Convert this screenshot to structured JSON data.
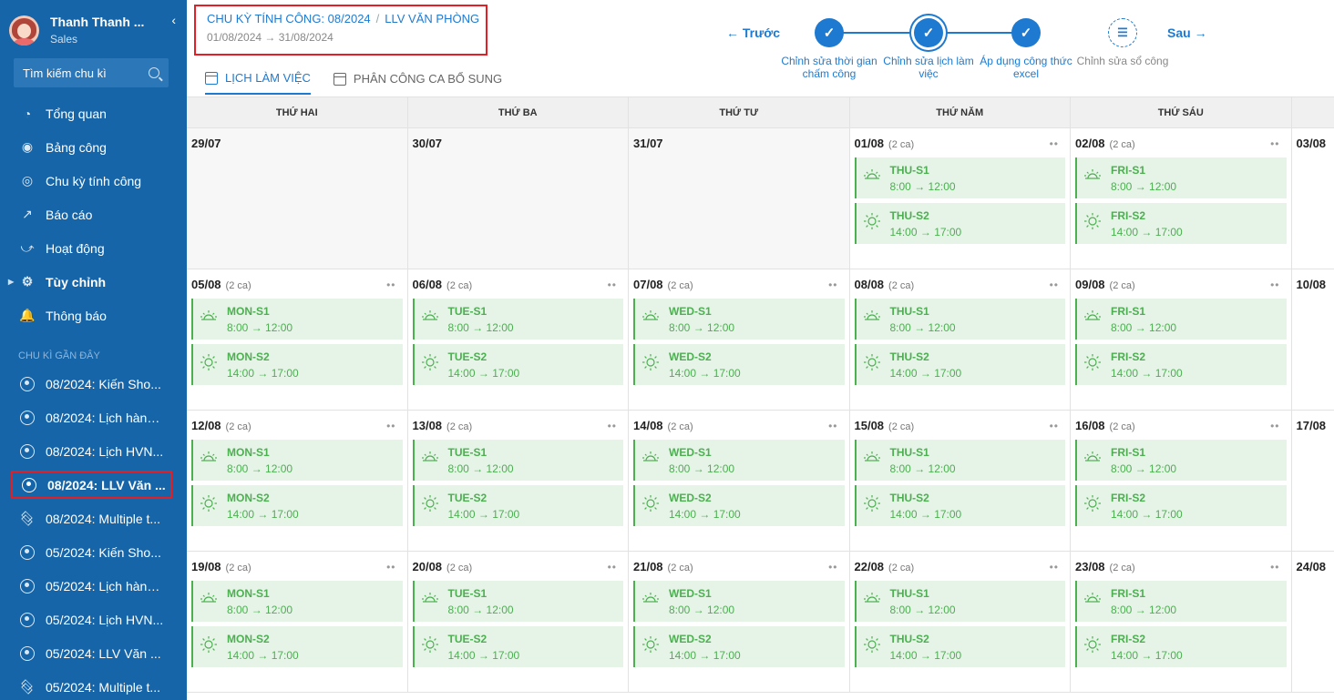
{
  "user": {
    "name": "Thanh Thanh ...",
    "role": "Sales"
  },
  "search": {
    "placeholder": "Tìm kiếm chu kì"
  },
  "nav": [
    {
      "label": "Tổng quan",
      "icon": "clock-icon"
    },
    {
      "label": "Bảng công",
      "icon": "user-icon"
    },
    {
      "label": "Chu kỳ tính công",
      "icon": "cycle-icon"
    },
    {
      "label": "Báo cáo",
      "icon": "chart-icon"
    },
    {
      "label": "Hoạt động",
      "icon": "activity-icon"
    },
    {
      "label": "Tùy chỉnh",
      "icon": "gear-icon"
    },
    {
      "label": "Thông báo",
      "icon": "bell-icon"
    }
  ],
  "recent_label": "CHU KÌ GẦN ĐÂY",
  "recent": [
    {
      "label": "08/2024: Kiến Sho...",
      "icon": "radio"
    },
    {
      "label": "08/2024: Lịch hành...",
      "icon": "radio"
    },
    {
      "label": "08/2024: Lịch HVN...",
      "icon": "radio"
    },
    {
      "label": "08/2024: LLV Văn ...",
      "icon": "radio",
      "active": true
    },
    {
      "label": "08/2024: Multiple t...",
      "icon": "layers"
    },
    {
      "label": "05/2024: Kiến Sho...",
      "icon": "radio"
    },
    {
      "label": "05/2024: Lịch hành...",
      "icon": "radio"
    },
    {
      "label": "05/2024: Lịch HVN...",
      "icon": "radio"
    },
    {
      "label": "05/2024: LLV Văn ...",
      "icon": "radio"
    },
    {
      "label": "05/2024: Multiple t...",
      "icon": "layers"
    }
  ],
  "header": {
    "cycle": "CHU KỲ TÍNH CÔNG: 08/2024",
    "schedule": "LLV VĂN PHÒNG",
    "start": "01/08/2024",
    "end": "31/08/2024"
  },
  "tabs": [
    "LỊCH LÀM VIỆC",
    "PHÂN CÔNG CA BỔ SUNG"
  ],
  "stepper": {
    "prev": "← Trước",
    "next": "Sau →",
    "steps": [
      "Chỉnh sửa thời gian chấm công",
      "Chỉnh sửa lịch làm việc",
      "Áp dụng công thức excel",
      "Chỉnh sửa sổ công"
    ]
  },
  "weekdays": [
    "THỨ HAI",
    "THỨ BA",
    "THỨ TƯ",
    "THỨ NĂM",
    "THỨ SÁU"
  ],
  "count_label": "(2 ca)",
  "weeks": [
    [
      {
        "date": "29/07"
      },
      {
        "date": "30/07"
      },
      {
        "date": "31/07"
      },
      {
        "date": "01/08",
        "shifts": [
          {
            "name": "THU-S1",
            "time": "8:00 → 12:00"
          },
          {
            "name": "THU-S2",
            "time": "14:00 → 17:00"
          }
        ]
      },
      {
        "date": "02/08",
        "shifts": [
          {
            "name": "FRI-S1",
            "time": "8:00 → 12:00"
          },
          {
            "name": "FRI-S2",
            "time": "14:00 → 17:00"
          }
        ]
      },
      {
        "date": "03/08"
      }
    ],
    [
      {
        "date": "05/08",
        "shifts": [
          {
            "name": "MON-S1",
            "time": "8:00 → 12:00"
          },
          {
            "name": "MON-S2",
            "time": "14:00 → 17:00"
          }
        ]
      },
      {
        "date": "06/08",
        "shifts": [
          {
            "name": "TUE-S1",
            "time": "8:00 → 12:00"
          },
          {
            "name": "TUE-S2",
            "time": "14:00 → 17:00"
          }
        ]
      },
      {
        "date": "07/08",
        "shifts": [
          {
            "name": "WED-S1",
            "time": "8:00 → 12:00"
          },
          {
            "name": "WED-S2",
            "time": "14:00 → 17:00"
          }
        ]
      },
      {
        "date": "08/08",
        "shifts": [
          {
            "name": "THU-S1",
            "time": "8:00 → 12:00"
          },
          {
            "name": "THU-S2",
            "time": "14:00 → 17:00"
          }
        ]
      },
      {
        "date": "09/08",
        "shifts": [
          {
            "name": "FRI-S1",
            "time": "8:00 → 12:00"
          },
          {
            "name": "FRI-S2",
            "time": "14:00 → 17:00"
          }
        ]
      },
      {
        "date": "10/08"
      }
    ],
    [
      {
        "date": "12/08",
        "shifts": [
          {
            "name": "MON-S1",
            "time": "8:00 → 12:00"
          },
          {
            "name": "MON-S2",
            "time": "14:00 → 17:00"
          }
        ]
      },
      {
        "date": "13/08",
        "shifts": [
          {
            "name": "TUE-S1",
            "time": "8:00 → 12:00"
          },
          {
            "name": "TUE-S2",
            "time": "14:00 → 17:00"
          }
        ]
      },
      {
        "date": "14/08",
        "shifts": [
          {
            "name": "WED-S1",
            "time": "8:00 → 12:00"
          },
          {
            "name": "WED-S2",
            "time": "14:00 → 17:00"
          }
        ]
      },
      {
        "date": "15/08",
        "shifts": [
          {
            "name": "THU-S1",
            "time": "8:00 → 12:00"
          },
          {
            "name": "THU-S2",
            "time": "14:00 → 17:00"
          }
        ]
      },
      {
        "date": "16/08",
        "shifts": [
          {
            "name": "FRI-S1",
            "time": "8:00 → 12:00"
          },
          {
            "name": "FRI-S2",
            "time": "14:00 → 17:00"
          }
        ]
      },
      {
        "date": "17/08"
      }
    ],
    [
      {
        "date": "19/08",
        "shifts": [
          {
            "name": "MON-S1",
            "time": "8:00 → 12:00"
          },
          {
            "name": "MON-S2",
            "time": "14:00 → 17:00"
          }
        ]
      },
      {
        "date": "20/08",
        "shifts": [
          {
            "name": "TUE-S1",
            "time": "8:00 → 12:00"
          },
          {
            "name": "TUE-S2",
            "time": "14:00 → 17:00"
          }
        ]
      },
      {
        "date": "21/08",
        "shifts": [
          {
            "name": "WED-S1",
            "time": "8:00 → 12:00"
          },
          {
            "name": "WED-S2",
            "time": "14:00 → 17:00"
          }
        ]
      },
      {
        "date": "22/08",
        "shifts": [
          {
            "name": "THU-S1",
            "time": "8:00 → 12:00"
          },
          {
            "name": "THU-S2",
            "time": "14:00 → 17:00"
          }
        ]
      },
      {
        "date": "23/08",
        "shifts": [
          {
            "name": "FRI-S1",
            "time": "8:00 → 12:00"
          },
          {
            "name": "FRI-S2",
            "time": "14:00 → 17:00"
          }
        ]
      },
      {
        "date": "24/08"
      }
    ]
  ],
  "colors": {
    "sidebar": "#1565a8",
    "accent": "#1e7ad0",
    "shift_bg": "#e6f4e8",
    "shift_fg": "#4caf50",
    "highlight": "#e31e24"
  }
}
